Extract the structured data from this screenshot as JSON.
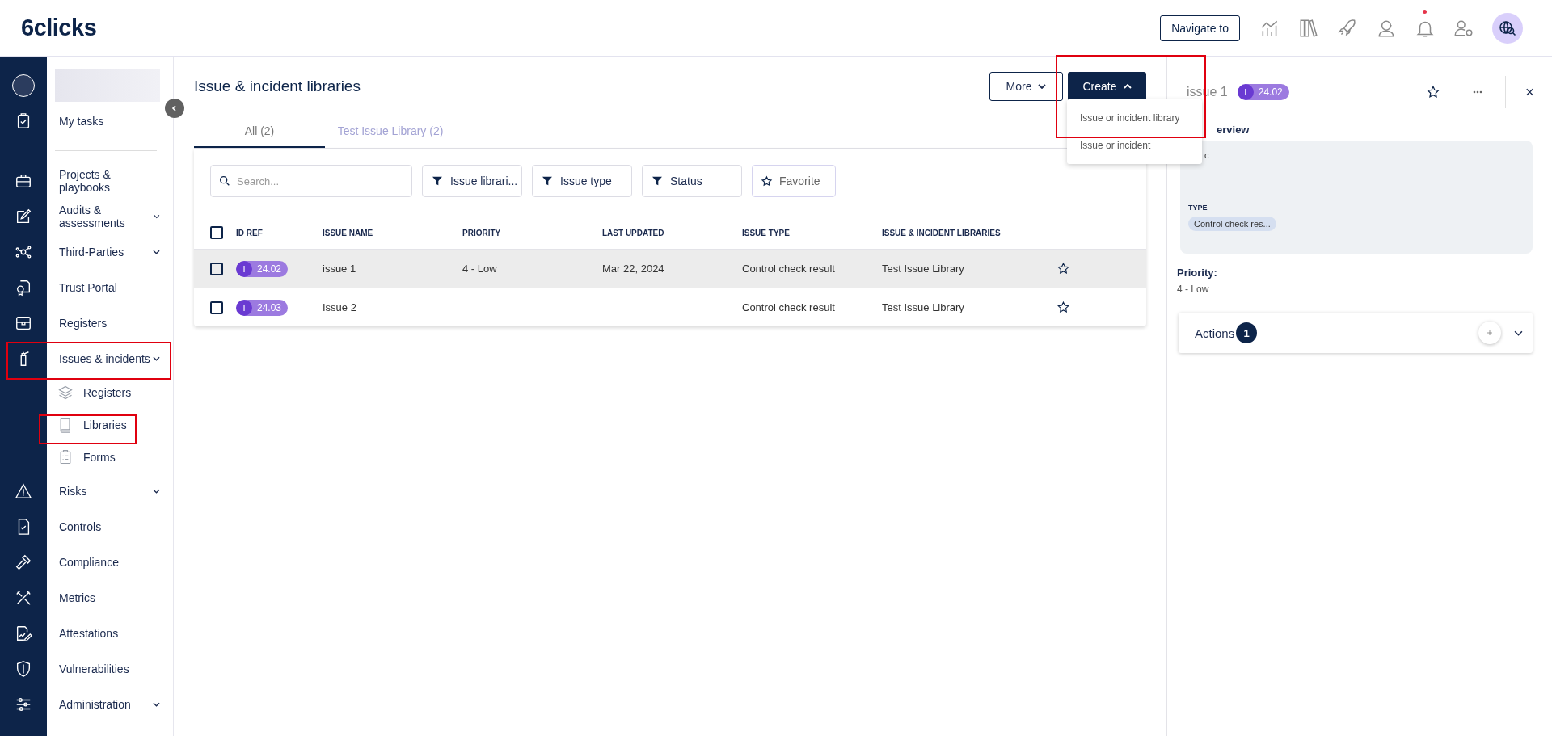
{
  "topbar": {
    "logo": "6clicks",
    "navigate_button": "Navigate to",
    "notification_dot": true
  },
  "sidebar": {
    "items": [
      {
        "label": "My tasks",
        "expandable": false
      },
      {
        "label": "Projects & playbooks",
        "expandable": false
      },
      {
        "label": "Audits & assessments",
        "expandable": true
      },
      {
        "label": "Third-Parties",
        "expandable": true
      },
      {
        "label": "Trust Portal",
        "expandable": false
      },
      {
        "label": "Registers",
        "expandable": false
      },
      {
        "label": "Issues & incidents",
        "expandable": true,
        "children": [
          {
            "label": "Registers"
          },
          {
            "label": "Libraries"
          },
          {
            "label": "Forms"
          }
        ]
      },
      {
        "label": "Risks",
        "expandable": true
      },
      {
        "label": "Controls",
        "expandable": false
      },
      {
        "label": "Compliance",
        "expandable": false
      },
      {
        "label": "Metrics",
        "expandable": false
      },
      {
        "label": "Attestations",
        "expandable": false
      },
      {
        "label": "Vulnerabilities",
        "expandable": false
      },
      {
        "label": "Administration",
        "expandable": true
      }
    ]
  },
  "page": {
    "title": "Issue & incident libraries",
    "more_button": "More",
    "create_button": "Create",
    "create_menu": [
      "Issue or incident library",
      "Issue or incident"
    ],
    "tabs": [
      {
        "label": "All (2)",
        "selected": true
      },
      {
        "label": "Test Issue Library (2)",
        "selected": false
      }
    ],
    "search": {
      "placeholder": "Search..."
    },
    "filters": [
      "Issue librari...",
      "Issue type",
      "Status"
    ],
    "favorite_button": "Favorite",
    "table": {
      "select_all_checked": false,
      "columns": [
        "ID REF",
        "ISSUE NAME",
        "PRIORITY",
        "LAST UPDATED",
        "ISSUE TYPE",
        "ISSUE & INCIDENT LIBRARIES"
      ],
      "rows": [
        {
          "selected": true,
          "checked": false,
          "badge_letter": "I",
          "id_ref": "24.02",
          "name": "issue 1",
          "priority": "4 - Low",
          "last_updated": "Mar 22, 2024",
          "issue_type": "Control check result",
          "library": "Test Issue Library"
        },
        {
          "selected": false,
          "checked": false,
          "badge_letter": "I",
          "id_ref": "24.03",
          "name": "Issue 2",
          "priority": "",
          "last_updated": "",
          "issue_type": "Control check result",
          "library": "Test Issue Library"
        }
      ]
    }
  },
  "detail": {
    "title": "issue 1",
    "badge_letter": "I",
    "id_ref": "24.02",
    "section_fragment": "erview",
    "field_fragment": "c",
    "type_label": "TYPE",
    "type_chip": "Control check res...",
    "priority_label": "Priority:",
    "priority_value": "4 - Low",
    "actions_label": "Actions",
    "actions_count": "1"
  }
}
